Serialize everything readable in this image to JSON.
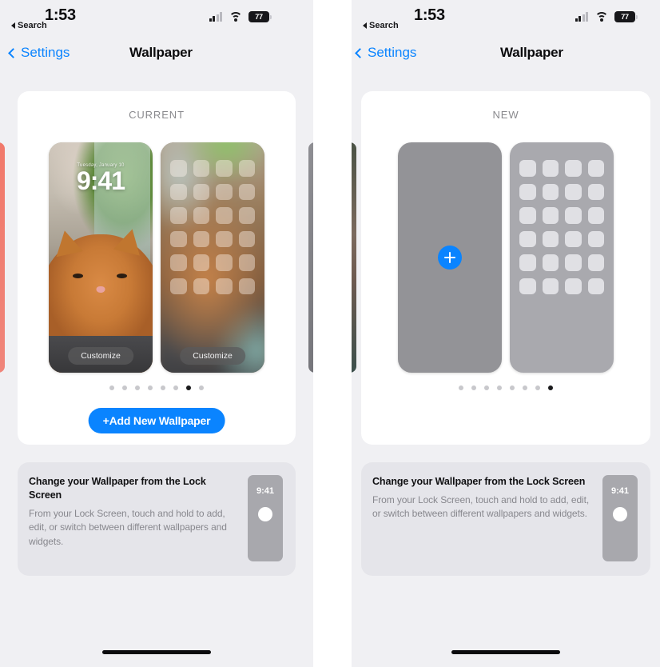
{
  "status_bar": {
    "time": "1:53",
    "back_label": "Search",
    "battery_percent": "77",
    "icons": [
      "cellular-signal-icon",
      "wifi-icon",
      "battery-icon"
    ]
  },
  "nav": {
    "back_label": "Settings",
    "title": "Wallpaper"
  },
  "panels": [
    {
      "id": "current",
      "section_header": "CURRENT",
      "lock_preview": {
        "date": "Tuesday, January 10",
        "time": "9:41",
        "customize_label": "Customize"
      },
      "home_preview": {
        "customize_label": "Customize"
      },
      "page_dots": {
        "count": 8,
        "active_index": 6
      },
      "add_button_label": "+Add New Wallpaper"
    },
    {
      "id": "new",
      "section_header": "NEW",
      "add_tile": {
        "plus_label": "+"
      },
      "page_dots": {
        "count": 8,
        "active_index": 7
      }
    }
  ],
  "info_card": {
    "title": "Change your Wallpaper from the Lock Screen",
    "body": "From your Lock Screen, touch and hold to add, edit, or switch between different wallpapers and widgets.",
    "mini_phone_time": "9:41"
  },
  "colors": {
    "accent_blue": "#0a84ff",
    "page_background": "#f0f0f3",
    "card_background": "#ffffff",
    "info_card_background": "#e5e5ea",
    "secondary_text": "#8a8a8e"
  }
}
